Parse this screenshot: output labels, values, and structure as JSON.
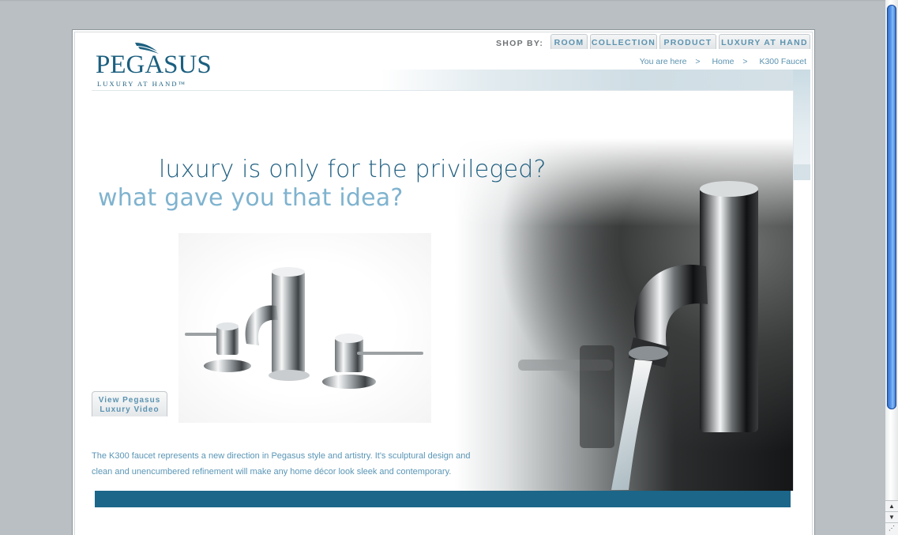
{
  "brand": {
    "name": "PEGASUS",
    "tagline": "LUXURY AT HAND™"
  },
  "nav": {
    "shop_by_label": "SHOP BY:",
    "tabs": [
      {
        "label": "ROOM"
      },
      {
        "label": "COLLECTION"
      },
      {
        "label": "PRODUCT"
      },
      {
        "label": "LUXURY AT HAND"
      }
    ]
  },
  "breadcrumb": {
    "prefix": "You are here",
    "separator": ">",
    "items": [
      "Home",
      "K300 Faucet"
    ]
  },
  "hero": {
    "headline_line1": "luxury is only for the privileged?",
    "headline_line2": "what gave you that idea?",
    "video_button_line1": "View Pegasus",
    "video_button_line2": "Luxury Video",
    "description": "The K300 faucet represents a new direction in Pegasus style and artistry. It's sculptural design and clean and unencumbered refinement will make any home décor look sleek and contemporary."
  },
  "colors": {
    "brand_blue": "#1b5f7f",
    "accent_light_blue": "#7fb3cf",
    "link_blue": "#5b93b0",
    "footer_bar": "#1b6689",
    "page_background": "#b9bfc3"
  },
  "icons": {
    "scroll_up": "up-arrow-icon",
    "scroll_down": "down-arrow-icon"
  }
}
